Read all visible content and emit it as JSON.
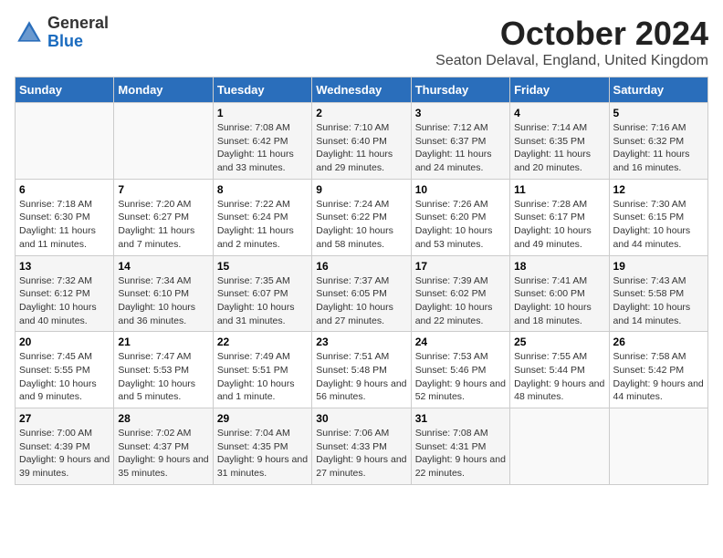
{
  "logo": {
    "general": "General",
    "blue": "Blue"
  },
  "title": "October 2024",
  "location": "Seaton Delaval, England, United Kingdom",
  "days_of_week": [
    "Sunday",
    "Monday",
    "Tuesday",
    "Wednesday",
    "Thursday",
    "Friday",
    "Saturday"
  ],
  "weeks": [
    [
      {
        "day": "",
        "info": ""
      },
      {
        "day": "",
        "info": ""
      },
      {
        "day": "1",
        "info": "Sunrise: 7:08 AM\nSunset: 6:42 PM\nDaylight: 11 hours and 33 minutes."
      },
      {
        "day": "2",
        "info": "Sunrise: 7:10 AM\nSunset: 6:40 PM\nDaylight: 11 hours and 29 minutes."
      },
      {
        "day": "3",
        "info": "Sunrise: 7:12 AM\nSunset: 6:37 PM\nDaylight: 11 hours and 24 minutes."
      },
      {
        "day": "4",
        "info": "Sunrise: 7:14 AM\nSunset: 6:35 PM\nDaylight: 11 hours and 20 minutes."
      },
      {
        "day": "5",
        "info": "Sunrise: 7:16 AM\nSunset: 6:32 PM\nDaylight: 11 hours and 16 minutes."
      }
    ],
    [
      {
        "day": "6",
        "info": "Sunrise: 7:18 AM\nSunset: 6:30 PM\nDaylight: 11 hours and 11 minutes."
      },
      {
        "day": "7",
        "info": "Sunrise: 7:20 AM\nSunset: 6:27 PM\nDaylight: 11 hours and 7 minutes."
      },
      {
        "day": "8",
        "info": "Sunrise: 7:22 AM\nSunset: 6:24 PM\nDaylight: 11 hours and 2 minutes."
      },
      {
        "day": "9",
        "info": "Sunrise: 7:24 AM\nSunset: 6:22 PM\nDaylight: 10 hours and 58 minutes."
      },
      {
        "day": "10",
        "info": "Sunrise: 7:26 AM\nSunset: 6:20 PM\nDaylight: 10 hours and 53 minutes."
      },
      {
        "day": "11",
        "info": "Sunrise: 7:28 AM\nSunset: 6:17 PM\nDaylight: 10 hours and 49 minutes."
      },
      {
        "day": "12",
        "info": "Sunrise: 7:30 AM\nSunset: 6:15 PM\nDaylight: 10 hours and 44 minutes."
      }
    ],
    [
      {
        "day": "13",
        "info": "Sunrise: 7:32 AM\nSunset: 6:12 PM\nDaylight: 10 hours and 40 minutes."
      },
      {
        "day": "14",
        "info": "Sunrise: 7:34 AM\nSunset: 6:10 PM\nDaylight: 10 hours and 36 minutes."
      },
      {
        "day": "15",
        "info": "Sunrise: 7:35 AM\nSunset: 6:07 PM\nDaylight: 10 hours and 31 minutes."
      },
      {
        "day": "16",
        "info": "Sunrise: 7:37 AM\nSunset: 6:05 PM\nDaylight: 10 hours and 27 minutes."
      },
      {
        "day": "17",
        "info": "Sunrise: 7:39 AM\nSunset: 6:02 PM\nDaylight: 10 hours and 22 minutes."
      },
      {
        "day": "18",
        "info": "Sunrise: 7:41 AM\nSunset: 6:00 PM\nDaylight: 10 hours and 18 minutes."
      },
      {
        "day": "19",
        "info": "Sunrise: 7:43 AM\nSunset: 5:58 PM\nDaylight: 10 hours and 14 minutes."
      }
    ],
    [
      {
        "day": "20",
        "info": "Sunrise: 7:45 AM\nSunset: 5:55 PM\nDaylight: 10 hours and 9 minutes."
      },
      {
        "day": "21",
        "info": "Sunrise: 7:47 AM\nSunset: 5:53 PM\nDaylight: 10 hours and 5 minutes."
      },
      {
        "day": "22",
        "info": "Sunrise: 7:49 AM\nSunset: 5:51 PM\nDaylight: 10 hours and 1 minute."
      },
      {
        "day": "23",
        "info": "Sunrise: 7:51 AM\nSunset: 5:48 PM\nDaylight: 9 hours and 56 minutes."
      },
      {
        "day": "24",
        "info": "Sunrise: 7:53 AM\nSunset: 5:46 PM\nDaylight: 9 hours and 52 minutes."
      },
      {
        "day": "25",
        "info": "Sunrise: 7:55 AM\nSunset: 5:44 PM\nDaylight: 9 hours and 48 minutes."
      },
      {
        "day": "26",
        "info": "Sunrise: 7:58 AM\nSunset: 5:42 PM\nDaylight: 9 hours and 44 minutes."
      }
    ],
    [
      {
        "day": "27",
        "info": "Sunrise: 7:00 AM\nSunset: 4:39 PM\nDaylight: 9 hours and 39 minutes."
      },
      {
        "day": "28",
        "info": "Sunrise: 7:02 AM\nSunset: 4:37 PM\nDaylight: 9 hours and 35 minutes."
      },
      {
        "day": "29",
        "info": "Sunrise: 7:04 AM\nSunset: 4:35 PM\nDaylight: 9 hours and 31 minutes."
      },
      {
        "day": "30",
        "info": "Sunrise: 7:06 AM\nSunset: 4:33 PM\nDaylight: 9 hours and 27 minutes."
      },
      {
        "day": "31",
        "info": "Sunrise: 7:08 AM\nSunset: 4:31 PM\nDaylight: 9 hours and 22 minutes."
      },
      {
        "day": "",
        "info": ""
      },
      {
        "day": "",
        "info": ""
      }
    ]
  ]
}
